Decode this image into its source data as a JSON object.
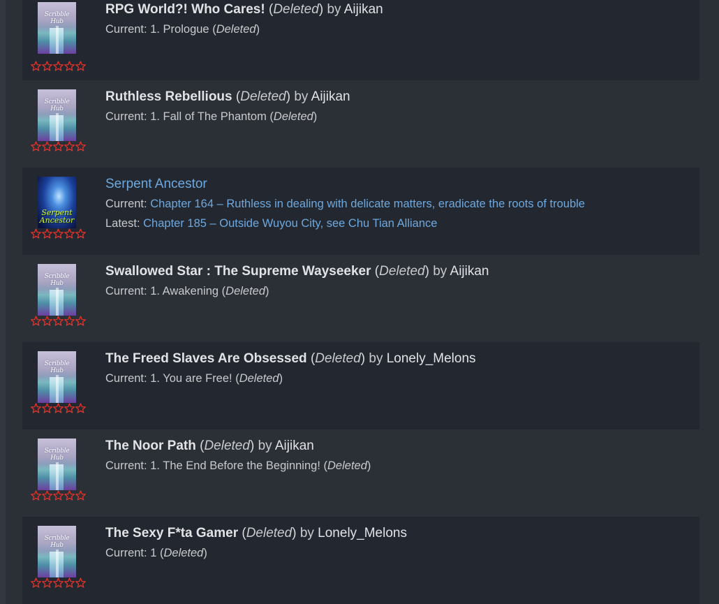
{
  "entries": [
    {
      "title": "RPG World?! Who Cares!",
      "deleted_label": "Deleted",
      "by": "by",
      "author": "Aijikan",
      "current_label": "Current:",
      "current": "1. Prologue",
      "cover_text": "Scribble Hub",
      "rating": 0
    },
    {
      "title": "Ruthless Rebellious",
      "deleted_label": "Deleted",
      "by": "by",
      "author": "Aijikan",
      "current_label": "Current:",
      "current": "1. Fall of The Phantom",
      "cover_text": "Scribble Hub",
      "rating": 0
    },
    {
      "title": "Serpent Ancestor",
      "current_label": "Current:",
      "current": "Chapter 164 – Ruthless in dealing with delicate matters, eradicate the roots of trouble",
      "latest_label": "Latest:",
      "latest": "Chapter 185 – Outside Wuyou City, see Chu Tian Alliance",
      "cover_text": "Serpent Ancestor",
      "rating": 0
    },
    {
      "title": "Swallowed Star : The Supreme Wayseeker",
      "deleted_label": "Deleted",
      "by": "by",
      "author": "Aijikan",
      "current_label": "Current:",
      "current": "1. Awakening",
      "cover_text": "Scribble Hub",
      "rating": 0
    },
    {
      "title": "The Freed Slaves Are Obsessed",
      "deleted_label": "Deleted",
      "by": "by",
      "author": "Lonely_Melons",
      "current_label": "Current:",
      "current": "1. You are Free!",
      "cover_text": "Scribble Hub",
      "rating": 0
    },
    {
      "title": "The Noor Path",
      "deleted_label": "Deleted",
      "by": "by",
      "author": "Aijikan",
      "current_label": "Current:",
      "current": "1. The End Before the Beginning!",
      "cover_text": "Scribble Hub",
      "rating": 0
    },
    {
      "title": "The Sexy F*ta Gamer",
      "deleted_label": "Deleted",
      "by": "by",
      "author": "Lonely_Melons",
      "current_label": "Current:",
      "current": "1",
      "cover_text": "Scribble Hub",
      "rating": 0
    }
  ],
  "colors": {
    "star_outline": "#e0342c",
    "link": "#6ea8de",
    "row_dark": "#232830",
    "row_light": "#2b2f36"
  },
  "icons": {
    "rating": "star-outline-icon"
  }
}
